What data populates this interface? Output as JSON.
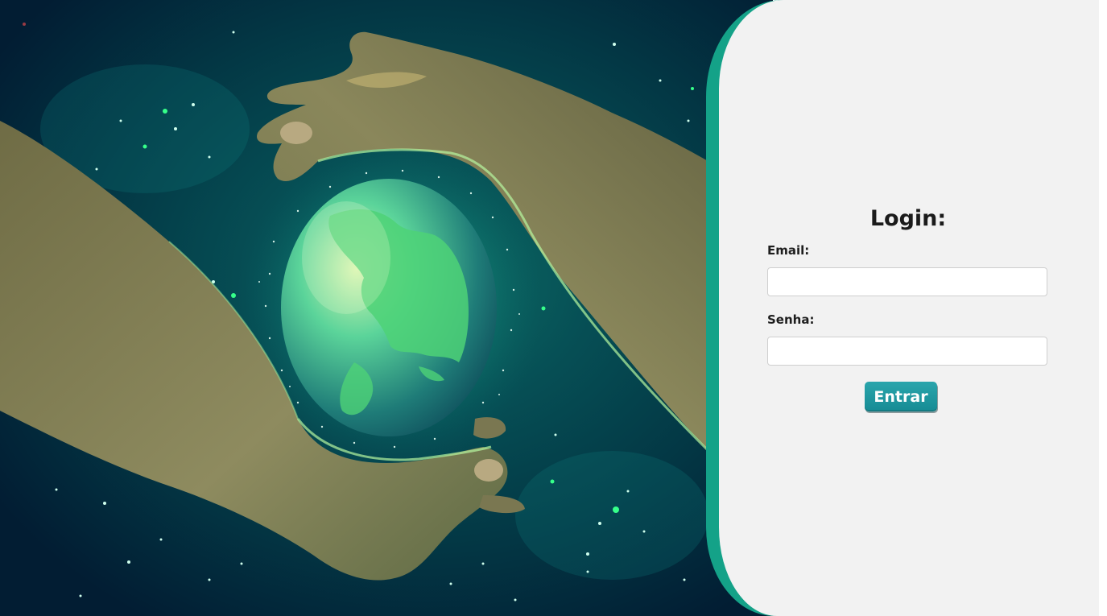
{
  "hero": {
    "illustration": "hands-holding-glowing-earth-illustration",
    "colors": {
      "space_dark": "#021d33",
      "space_teal": "#0d6e66",
      "globe_green": "#3fcf74",
      "hand_tone": "#8c8a5e"
    }
  },
  "panel": {
    "background": "#f2f2f2",
    "accent": "#14a288"
  },
  "login": {
    "title": "Login:",
    "email_label": "Email:",
    "email_value": "",
    "password_label": "Senha:",
    "password_value": "",
    "submit_label": "Entrar",
    "button_color": "#1e96a0"
  }
}
